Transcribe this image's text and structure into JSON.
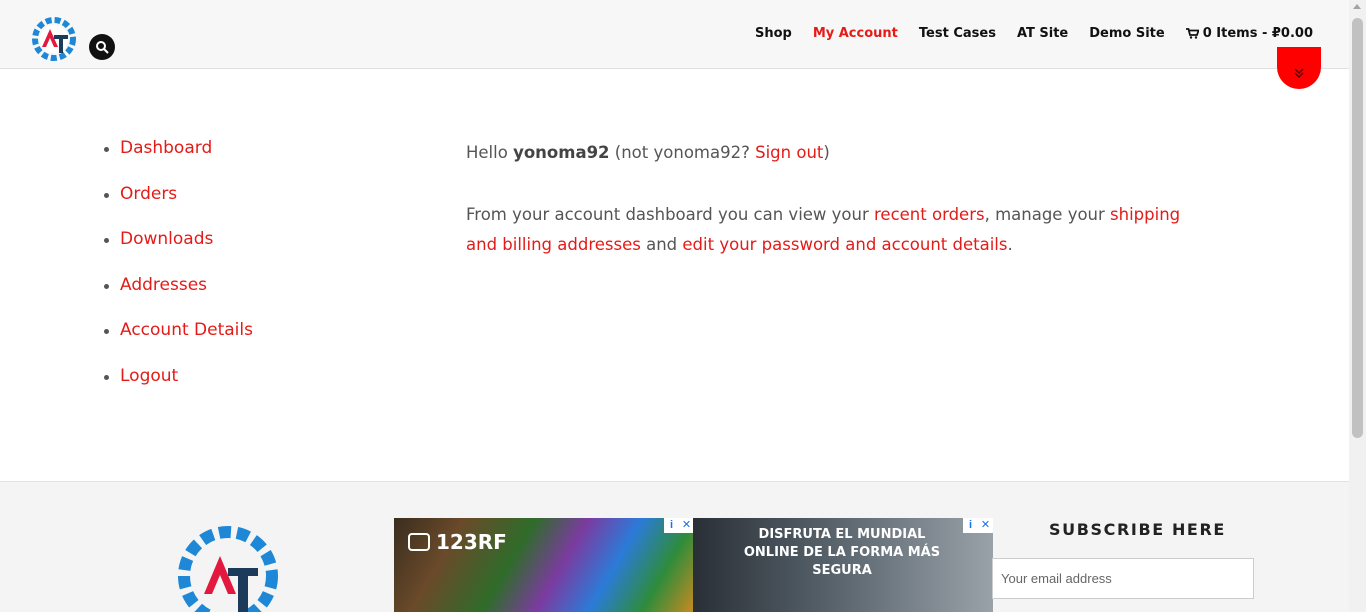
{
  "header": {
    "nav": [
      {
        "label": "Shop",
        "active": false
      },
      {
        "label": "My Account",
        "active": true
      },
      {
        "label": "Test Cases",
        "active": false
      },
      {
        "label": "AT Site",
        "active": false
      },
      {
        "label": "Demo Site",
        "active": false
      }
    ],
    "cart_label": "0 Items - ₽0.00"
  },
  "sidebar": {
    "items": [
      "Dashboard",
      "Orders",
      "Downloads",
      "Addresses",
      "Account Details",
      "Logout"
    ]
  },
  "content": {
    "hello_prefix": "Hello ",
    "username": "yonoma92",
    "not_prefix": " (not ",
    "not_user": "yonoma92",
    "not_q": "? ",
    "sign_out": "Sign out",
    "close_paren": ")",
    "intro_1": "From your account dashboard you can view your ",
    "recent_orders": "recent orders",
    "intro_2": ", manage your ",
    "addresses_link": "shipping and billing addresses",
    "intro_3": " and ",
    "account_link": "edit your password and account details",
    "intro_4": "."
  },
  "footer": {
    "ad1_brand": "123RF",
    "ad2_text": "DISFRUTA EL MUNDIAL ONLINE DE LA FORMA MÁS SEGURA",
    "subscribe_title": "SUBSCRIBE HERE",
    "email_placeholder": "Your email address"
  },
  "colors": {
    "accent": "#e41b17",
    "logo_blue": "#1e88d6",
    "logo_red": "#e3183e",
    "logo_navy": "#1c3a5a"
  },
  "icons": [
    "search-icon",
    "cart-icon",
    "chevron-double-down-icon",
    "ad-info-icon",
    "ad-close-icon"
  ]
}
